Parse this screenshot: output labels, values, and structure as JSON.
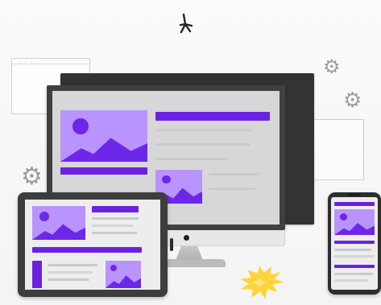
{
  "illustration": {
    "window_mark": "· · ·",
    "sparkle_icon": "sparkle-icon",
    "gear_icon": "gear-icon",
    "burst_icon": "starburst-icon",
    "colors": {
      "accent": "#6b22df",
      "accent_light": "#b994ff",
      "device_dark": "#333333",
      "screen_gray": "#d7d7d7",
      "highlight": "#ffd43b"
    }
  }
}
